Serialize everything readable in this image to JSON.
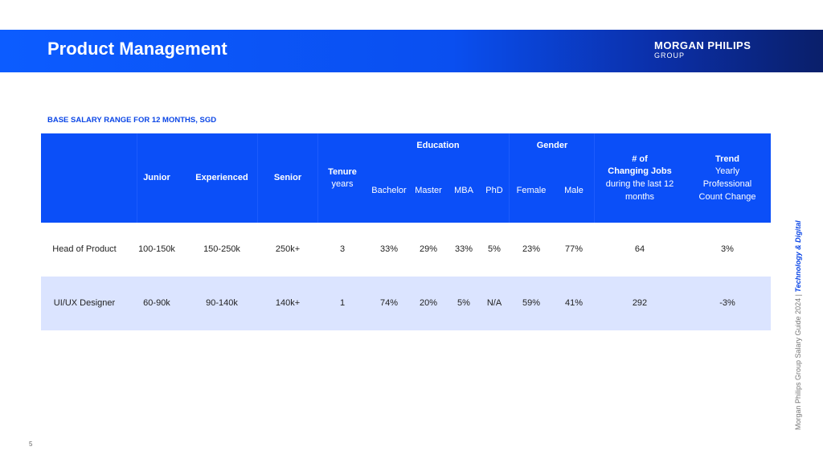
{
  "banner": {
    "title": "Product Management"
  },
  "logo": {
    "main": "MORGAN PHILIPS",
    "sub": "GROUP"
  },
  "subtitle": "BASE SALARY RANGE FOR 12 MONTHS, SGD",
  "table": {
    "headers": {
      "junior": "Junior",
      "experienced": "Experienced",
      "senior": "Senior",
      "tenure": "Tenure",
      "tenure_unit": "years",
      "education": "Education",
      "bachelor": "Bachelor",
      "master": "Master",
      "mba": "MBA",
      "phd": "PhD",
      "gender": "Gender",
      "female": "Female",
      "male": "Male",
      "changing_jobs_line1": "# of",
      "changing_jobs_line2": "Changing Jobs",
      "changing_jobs_line3": "during the last 12",
      "changing_jobs_line4": "months",
      "trend_line1": "Trend",
      "trend_line2": "Yearly",
      "trend_line3": "Professional",
      "trend_line4": "Count Change"
    },
    "rows": [
      {
        "role": "Head of Product",
        "junior": "100-150k",
        "experienced": "150-250k",
        "senior": "250k+",
        "tenure": "3",
        "bachelor": "33%",
        "master": "29%",
        "mba": "33%",
        "phd": "5%",
        "female": "23%",
        "male": "77%",
        "changing_jobs": "64",
        "trend": "3%"
      },
      {
        "role": "UI/UX Designer",
        "junior": "60-90k",
        "experienced": "90-140k",
        "senior": "140k+",
        "tenure": "1",
        "bachelor": "74%",
        "master": "20%",
        "mba": "5%",
        "phd": "N/A",
        "female": "59%",
        "male": "41%",
        "changing_jobs": "292",
        "trend": "-3%"
      }
    ]
  },
  "side_note": {
    "prefix": "Morgan Philips Group Salary Guide 2024 | ",
    "highlight": "Technology & Digital"
  },
  "page_number": "5"
}
